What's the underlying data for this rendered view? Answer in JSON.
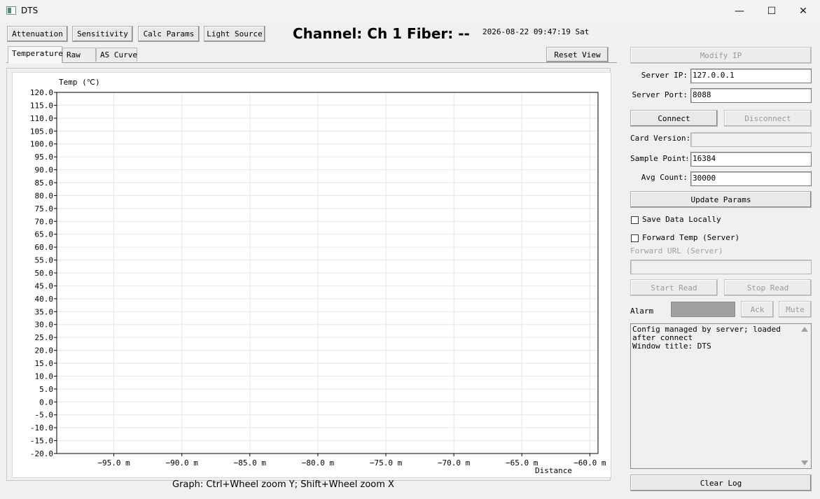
{
  "window": {
    "title": "DTS",
    "minimize": "—",
    "maximize": "☐",
    "close": "✕"
  },
  "toolbar": {
    "attenuation": "Attenuation",
    "sensitivity": "Sensitivity",
    "calc_params": "Calc Params",
    "light_source": "Light Source"
  },
  "status": {
    "channel": "Channel: Ch 1  Fiber: --",
    "datetime": "2026-08-22 09:47:19 Sat"
  },
  "tabs": [
    {
      "label": "Temperature",
      "active": true
    },
    {
      "label": "Raw",
      "active": false
    },
    {
      "label": "AS Curve",
      "active": false
    }
  ],
  "reset_view": "Reset View",
  "hint": "Graph: Ctrl+Wheel zoom Y; Shift+Wheel zoom X",
  "chart_data": {
    "type": "line",
    "ylabel": "Temp (℃)",
    "xlabel": "Distance",
    "ylim": [
      -20,
      120
    ],
    "xlim": [
      -99.2,
      -59.4
    ],
    "yticks": [
      120,
      115,
      110,
      105,
      100,
      95,
      90,
      85,
      80,
      75,
      70,
      65,
      60,
      55,
      50,
      45,
      40,
      35,
      30,
      25,
      20,
      15,
      10,
      5,
      0,
      -5,
      -10,
      -15,
      -20
    ],
    "ytick_labels": [
      "120.0",
      "115.0",
      "110.0",
      "105.0",
      "100.0",
      "95.0",
      "90.0",
      "85.0",
      "80.0",
      "75.0",
      "70.0",
      "65.0",
      "60.0",
      "55.0",
      "50.0",
      "45.0",
      "40.0",
      "35.0",
      "30.0",
      "25.0",
      "20.0",
      "15.0",
      "10.0",
      "5.0",
      "0.0",
      "-5.0",
      "-10.0",
      "-15.0",
      "-20.0"
    ],
    "xticks": [
      -95,
      -90,
      -85,
      -80,
      -75,
      -70,
      -65,
      -60
    ],
    "xtick_labels": [
      "−95.0 m",
      "−90.0 m",
      "−85.0 m",
      "−80.0 m",
      "−75.0 m",
      "−70.0 m",
      "−65.0 m",
      "−60.0 m"
    ],
    "grid": true,
    "series": []
  },
  "side": {
    "modify_ip": "Modify IP",
    "server_ip_label": "Server IP:",
    "server_ip": "127.0.0.1",
    "server_port_label": "Server Port:",
    "server_port": "8088",
    "connect": "Connect",
    "disconnect": "Disconnect",
    "card_version_label": "Card Version:",
    "card_version": "",
    "sample_points_label": "Sample Points:",
    "sample_points": "16384",
    "avg_count_label": "Avg Count:",
    "avg_count": "30000",
    "update_params": "Update Params",
    "save_local": "Save Data Locally",
    "forward_temp": "Forward Temp (Server)",
    "forward_url_label": "Forward URL (Server)",
    "forward_url": "",
    "start_read": "Start Read",
    "stop_read": "Stop Read",
    "alarm_label": "Alarm",
    "ack": "Ack",
    "mute": "Mute",
    "log": "Config managed by server; loaded after connect\nWindow title: DTS",
    "clear_log": "Clear Log"
  }
}
